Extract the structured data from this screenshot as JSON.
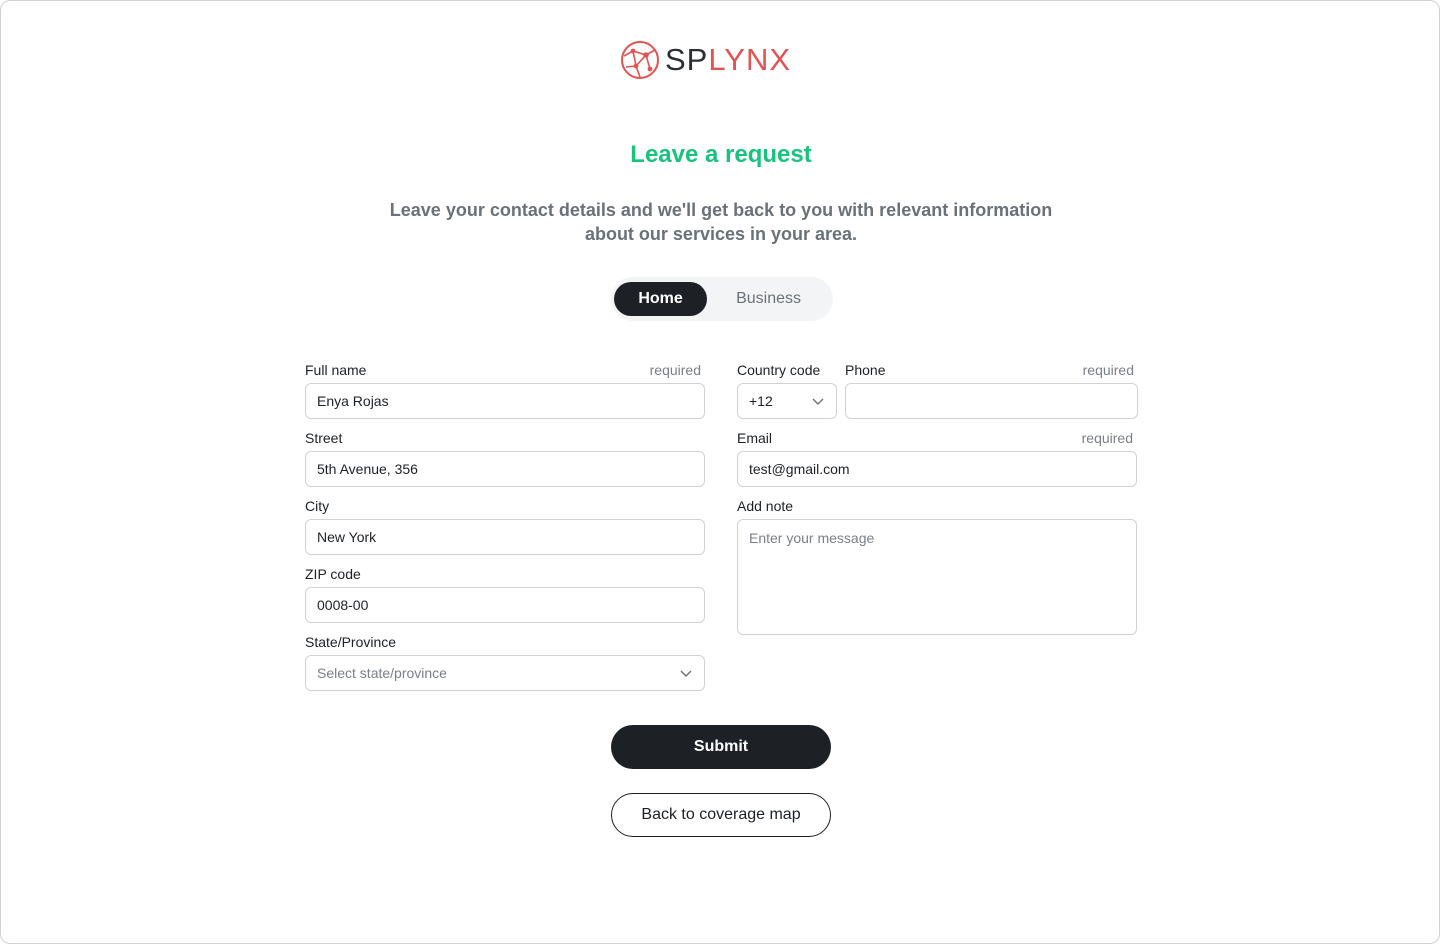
{
  "brand": {
    "logo_dark": "SP",
    "logo_red": "LYNX",
    "accent": "#e25353"
  },
  "page": {
    "title": "Leave a request",
    "subtitle_line1": "Leave your contact details and we'll get back to you with relevant information",
    "subtitle_line2": "about our services in your area."
  },
  "segmented": {
    "home": "Home",
    "business": "Business",
    "selected": "Home"
  },
  "form": {
    "full_name": {
      "label": "Full name",
      "required": "required",
      "value": "Enya Rojas"
    },
    "street": {
      "label": "Street",
      "value": "5th Avenue, 356"
    },
    "city": {
      "label": "City",
      "value": "New York"
    },
    "zip": {
      "label": "ZIP code",
      "value": "0008-00"
    },
    "state": {
      "label": "State/Province",
      "placeholder": "Select state/province"
    },
    "country_code": {
      "label": "Country code",
      "value": "+12"
    },
    "phone": {
      "label": "Phone",
      "required": "required",
      "value": ""
    },
    "email": {
      "label": "Email",
      "required": "required",
      "value": "test@gmail.com"
    },
    "note": {
      "label": "Add note",
      "placeholder": "Enter your message"
    }
  },
  "actions": {
    "submit": "Submit",
    "back": "Back to coverage map"
  },
  "colors": {
    "title_green": "#19c37d",
    "dark": "#1d2125",
    "muted": "#6b7178",
    "border": "#cfd3d8"
  }
}
